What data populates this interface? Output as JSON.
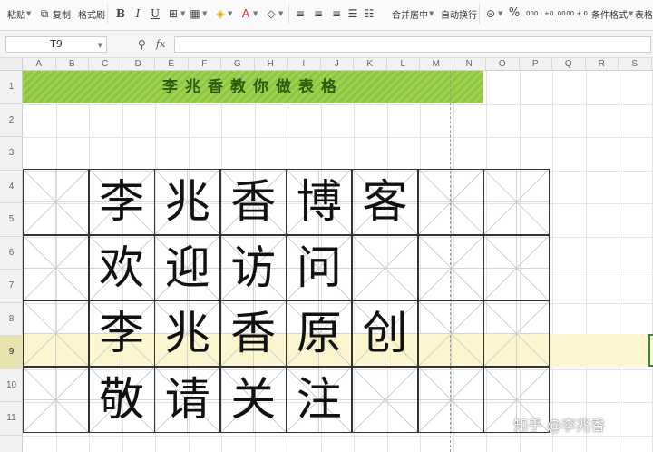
{
  "toolbar": {
    "paste_label": "粘贴",
    "copy_label": "复制",
    "format_painter_label": "格式刷",
    "merge_center_label": "合并居中",
    "wrap_text_label": "自动换行",
    "conditional_format_label": "条件格式",
    "table_style_label": "表格样式",
    "percent_symbol": "%",
    "thousands_symbol": "000",
    "inc_decimal_symbol": "+0 .00",
    "dec_decimal_symbol": ".00 +.0"
  },
  "formula_bar": {
    "name_box_value": "T9",
    "fx_label": "fx",
    "formula_value": ""
  },
  "columns": [
    "A",
    "B",
    "C",
    "D",
    "E",
    "F",
    "G",
    "H",
    "I",
    "J",
    "K",
    "L",
    "M",
    "N",
    "O",
    "P",
    "Q",
    "R",
    "S"
  ],
  "rows": [
    "1",
    "2",
    "3",
    "4",
    "5",
    "6",
    "7",
    "8",
    "9",
    "10",
    "11"
  ],
  "selected_row": "9",
  "sheet": {
    "title": "李兆香教你做表格",
    "grid_chars": [
      [
        "李",
        "兆",
        "香",
        "博",
        "客",
        "",
        ""
      ],
      [
        "欢",
        "迎",
        "访",
        "问",
        "",
        "",
        ""
      ],
      [
        "李",
        "兆",
        "香",
        "原",
        "创",
        "",
        ""
      ],
      [
        "敬",
        "请",
        "关",
        "注",
        "",
        "",
        ""
      ]
    ]
  },
  "watermark": "知乎 @李兆香",
  "colors": {
    "title_fill": "#8ec63f",
    "title_text": "#2e5a10",
    "selected_row_fill": "#fbf6cf",
    "active_cell_border": "#2f8a3a"
  }
}
